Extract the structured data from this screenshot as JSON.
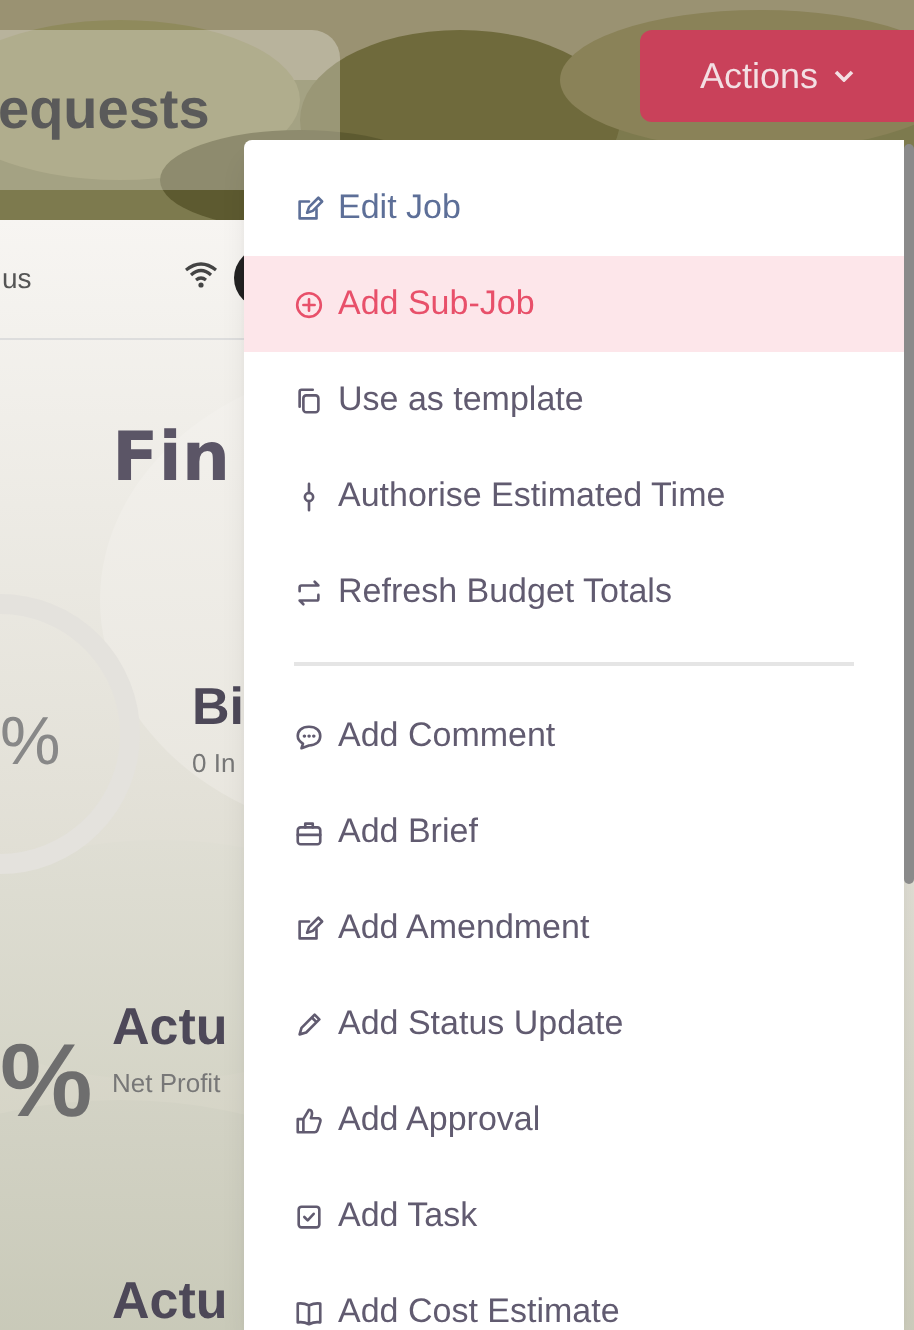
{
  "page_header": {
    "title": "equests"
  },
  "actions_button": {
    "label": "Actions"
  },
  "status_row": {
    "label": "us"
  },
  "finance": {
    "heading": "Fin",
    "gauge": {
      "value": "%"
    },
    "metrics": [
      {
        "title": "Bi",
        "subtitle": "0 In"
      },
      {
        "big": "%",
        "title": "Actu",
        "subtitle": "Net Profit"
      },
      {
        "title": "Actu"
      }
    ]
  },
  "menu": {
    "sections": [
      [
        {
          "label": "Edit Job",
          "focused": true,
          "selected": false
        },
        {
          "label": "Add Sub-Job",
          "focused": false,
          "selected": true
        },
        {
          "label": "Use as template",
          "focused": false,
          "selected": false
        },
        {
          "label": "Authorise Estimated Time",
          "focused": false,
          "selected": false
        },
        {
          "label": "Refresh Budget Totals",
          "focused": false,
          "selected": false
        }
      ],
      [
        {
          "label": "Add Comment",
          "focused": false,
          "selected": false
        },
        {
          "label": "Add Brief",
          "focused": false,
          "selected": false
        },
        {
          "label": "Add Amendment",
          "focused": false,
          "selected": false
        },
        {
          "label": "Add Status Update",
          "focused": false,
          "selected": false
        },
        {
          "label": "Add Approval",
          "focused": false,
          "selected": false
        },
        {
          "label": "Add Task",
          "focused": false,
          "selected": false
        },
        {
          "label": "Add Cost Estimate",
          "focused": false,
          "selected": false
        }
      ]
    ]
  }
}
